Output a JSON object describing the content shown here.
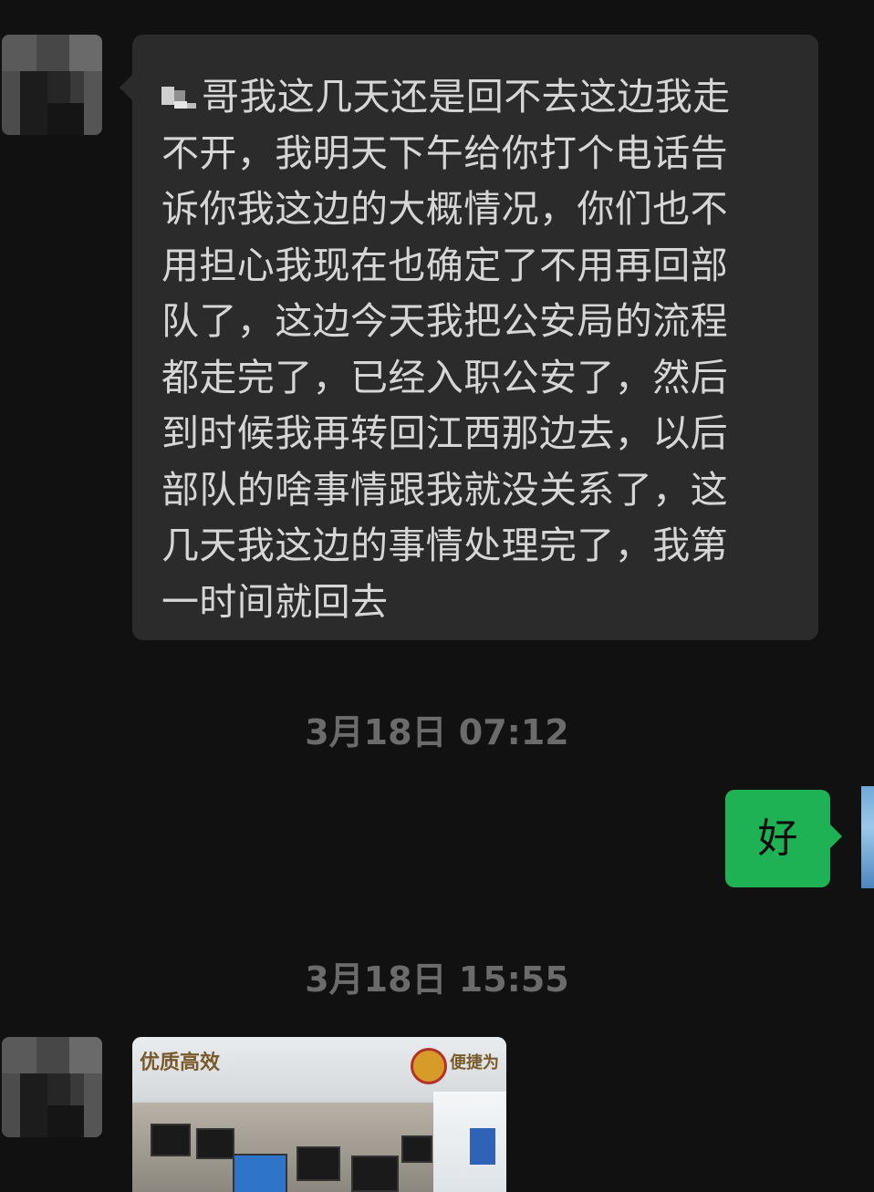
{
  "chat": {
    "incoming_message": {
      "lines": [
        "哥我这几天还是回不去这边我走",
        "不开，我明天下午给你打个电话告",
        "诉你我这边的大概情况，你们也不",
        "用担心我现在也确定了不用再回部",
        "队了，这边今天我把公安局的流程",
        "都走完了，已经入职公安了，然后",
        "到时候我再转回江西那边去，以后",
        "部队的啥事情跟我就没关系了，这",
        "几天我这边的事情处理完了，我第",
        "一时间就回去"
      ]
    },
    "timestamp_1": "3月18日 07:12",
    "outgoing_message": "好",
    "timestamp_2": "3月18日 15:55",
    "image_message": {
      "sign_left": "优质高效",
      "sign_right": "便捷为"
    }
  },
  "colors": {
    "background": "#111111",
    "incoming_bubble": "#2b2b2b",
    "outgoing_bubble": "#1fb255",
    "timestamp_text": "#6b6b6b"
  }
}
